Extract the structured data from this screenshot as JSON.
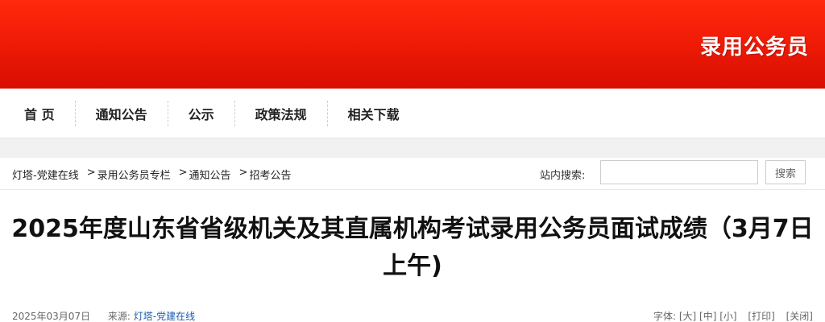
{
  "banner": {
    "title": "录用公务员"
  },
  "nav": {
    "items": [
      "首 页",
      "通知公告",
      "公示",
      "政策法规",
      "相关下载"
    ]
  },
  "breadcrumb": {
    "home": "灯塔-党建在线",
    "sep": ">",
    "level1": "录用公务员专栏",
    "level2": "通知公告",
    "level3": "招考公告"
  },
  "search": {
    "label": "站内搜索:",
    "value": "",
    "button": "搜索"
  },
  "article": {
    "title": "2025年度山东省省级机关及其直属机构考试录用公务员面试成绩（3月7日上午)",
    "date": "2025年03月07日",
    "source_label": "来源:",
    "source": "灯塔-党建在线"
  },
  "tools": {
    "font_label": "字体:",
    "large": "[大]",
    "medium": "[中]",
    "small": "[小]",
    "print": "[打印]",
    "close": "[关闭]"
  },
  "colors": {
    "banner": "#e81405",
    "link": "#1a5cb0"
  }
}
